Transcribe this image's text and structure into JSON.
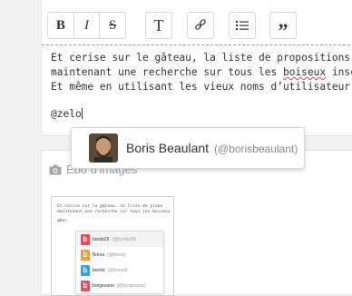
{
  "toolbar": {
    "bold": "B",
    "italic": "I",
    "strike": "S",
    "heading": "T",
    "link_icon": "link-icon",
    "list_icon": "list-icon",
    "quote": "”"
  },
  "editor": {
    "line1": "Et cerise sur le gâteau, la liste de propositions",
    "line2_pre": "maintenant une recherche sur tous les ",
    "line2_mis": "boiseux",
    "line2_post": " insc",
    "line3": "Et même en utilisant les vieux noms d’utilisateur",
    "line4": "@zelo"
  },
  "mention_popup": {
    "name": "Boris Beaulant",
    "handle": "(@borisbeaulant)"
  },
  "images_section": {
    "label": "Ebo d'images"
  },
  "thumbnail": {
    "line1": "Et cerise sur le gâteau, la liste de propo",
    "line2": "maintenant une recherche sur tous les boiseux",
    "line3": "@bor",
    "items": [
      {
        "name": "borda29",
        "handle": "(@borda29)",
        "color": "#e84a5f",
        "letter": "b"
      },
      {
        "name": "Borsa",
        "handle": "(@borsa)",
        "color": "#f39c3b",
        "letter": "b"
      },
      {
        "name": "bortoli",
        "handle": "(@bortoli)",
        "color": "#3b9ee8",
        "letter": "b"
      },
      {
        "name": "borgesano",
        "handle": "(@borgesano)",
        "color": "#e84a5f",
        "letter": "b"
      }
    ]
  }
}
